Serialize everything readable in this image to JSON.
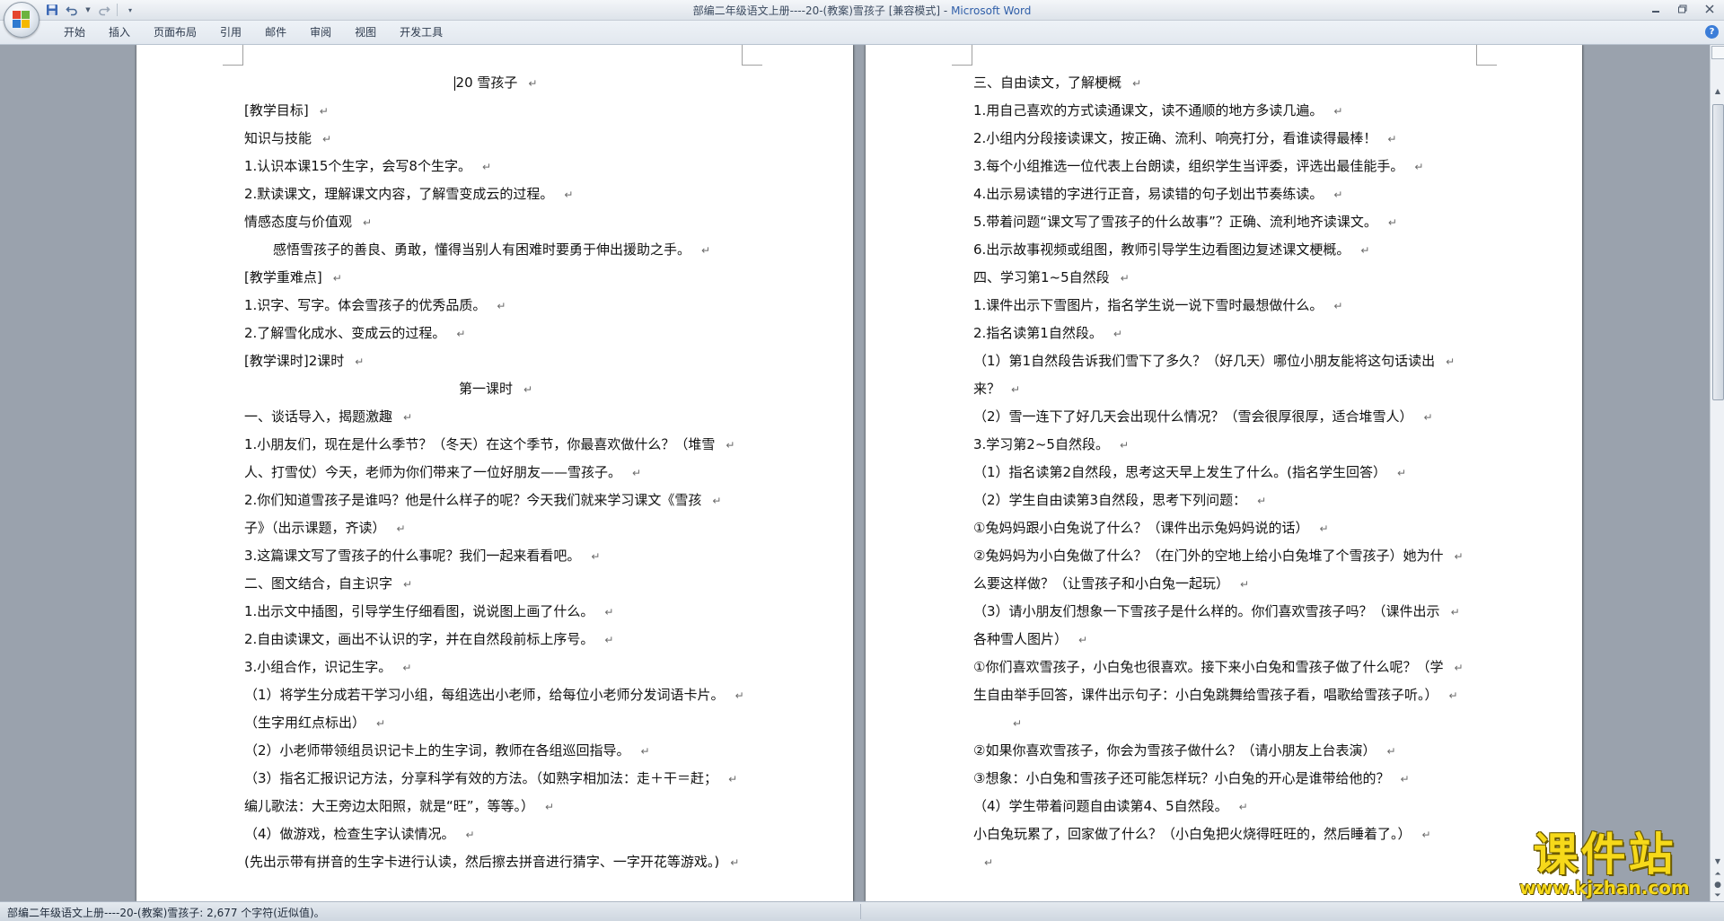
{
  "window": {
    "title_doc": "部编二年级语文上册----20-(教案)雪孩子 [兼容模式]",
    "title_sep": " - ",
    "title_app": "Microsoft Word"
  },
  "ribbon": {
    "tabs": [
      "开始",
      "插入",
      "页面布局",
      "引用",
      "邮件",
      "审阅",
      "视图",
      "开发工具"
    ]
  },
  "icons": {
    "office_button": "office-logo-icon",
    "save": "save-icon",
    "undo": "undo-icon",
    "redo": "redo-icon",
    "customize": "qat-dropdown-icon",
    "help": "help-icon"
  },
  "document": {
    "left_page": [
      "20 雪孩子",
      "[教学目标]",
      "知识与技能",
      "1.认识本课15个生字，会写8个生字。",
      "2.默读课文，理解课文内容，了解雪变成云的过程。",
      "情感态度与价值观",
      "感悟雪孩子的善良、勇敢，懂得当别人有困难时要勇于伸出援助之手。",
      "[教学重难点]",
      "1.识字、写字。体会雪孩子的优秀品质。",
      "2.了解雪化成水、变成云的过程。",
      "[教学课时]2课时",
      "第一课时",
      "一、谈话导入，揭题激趣",
      "1.小朋友们，现在是什么季节？（冬天）在这个季节，你最喜欢做什么？（堆雪",
      "人、打雪仗）今天，老师为你们带来了一位好朋友——雪孩子。",
      "2.你们知道雪孩子是谁吗？他是什么样子的呢？今天我们就来学习课文《雪孩",
      "子》（出示课题，齐读）",
      "3.这篇课文写了雪孩子的什么事呢？我们一起来看看吧。",
      "二、图文结合，自主识字",
      "1.出示文中插图，引导学生仔细看图，说说图上画了什么。",
      "2.自由读课文，画出不认识的字，并在自然段前标上序号。",
      "3.小组合作，识记生字。",
      "（1）将学生分成若干学习小组，每组选出小老师，给每位小老师分发词语卡片。",
      "（生字用红点标出）",
      "（2）小老师带领组员识记卡上的生字词，教师在各组巡回指导。",
      "（3）指名汇报识记方法，分享科学有效的方法。（如熟字相加法：走＋干＝赶；",
      "编儿歌法：大王旁边太阳照，就是“旺”，等等。）",
      "（4）做游戏，检查生字认读情况。",
      "(先出示带有拼音的生字卡进行认读，然后擦去拼音进行猜字、一字开花等游戏。)"
    ],
    "right_page": [
      "三、自由读文，了解梗概",
      "1.用自己喜欢的方式读通课文，读不通顺的地方多读几遍。",
      "2.小组内分段接读课文，按正确、流利、响亮打分，看谁读得最棒！",
      "3.每个小组推选一位代表上台朗读，组织学生当评委，评选出最佳能手。",
      "4.出示易读错的字进行正音，易读错的句子划出节奏练读。",
      "5.带着问题“课文写了雪孩子的什么故事”？正确、流利地齐读课文。",
      "6.出示故事视频或组图，教师引导学生边看图边复述课文梗概。",
      "四、学习第1~5自然段",
      "1.课件出示下雪图片，指名学生说一说下雪时最想做什么。",
      "2.指名读第1自然段。",
      "（1）第1自然段告诉我们雪下了多久？（好几天）哪位小朋友能将这句话读出",
      "来？",
      "（2）雪一连下了好几天会出现什么情况？（雪会很厚很厚，适合堆雪人）",
      "3.学习第2~5自然段。",
      "（1）指名读第2自然段，思考这天早上发生了什么。(指名学生回答）",
      "（2）学生自由读第3自然段，思考下列问题：",
      "①兔妈妈跟小白兔说了什么？（课件出示兔妈妈说的话）",
      "②兔妈妈为小白兔做了什么？（在门外的空地上给小白兔堆了个雪孩子）她为什",
      "么要这样做？（让雪孩子和小白兔一起玩）",
      "（3）请小朋友们想象一下雪孩子是什么样的。你们喜欢雪孩子吗？（课件出示",
      "各种雪人图片）",
      "①你们喜欢雪孩子，小白兔也很喜欢。接下来小白兔和雪孩子做了什么呢？（学",
      "生自由举手回答，课件出示句子：小白兔跳舞给雪孩子看，唱歌给雪孩子听。）",
      "",
      "②如果你喜欢雪孩子，你会为雪孩子做什么？（请小朋友上台表演）",
      "③想象：小白兔和雪孩子还可能怎样玩？小白兔的开心是谁带给他的？",
      "（4）学生带着问题自由读第4、5自然段。",
      "小白兔玩累了，回家做了什么？（小白兔把火烧得旺旺的，然后睡着了。）",
      ""
    ],
    "paragraph_mark": "↵"
  },
  "status": {
    "text": "部编二年级语文上册----20-(教案)雪孩子: 2,677 个字符(近似值)。"
  },
  "watermark": {
    "title": "课件站",
    "url": "www.kjzhan.com"
  }
}
